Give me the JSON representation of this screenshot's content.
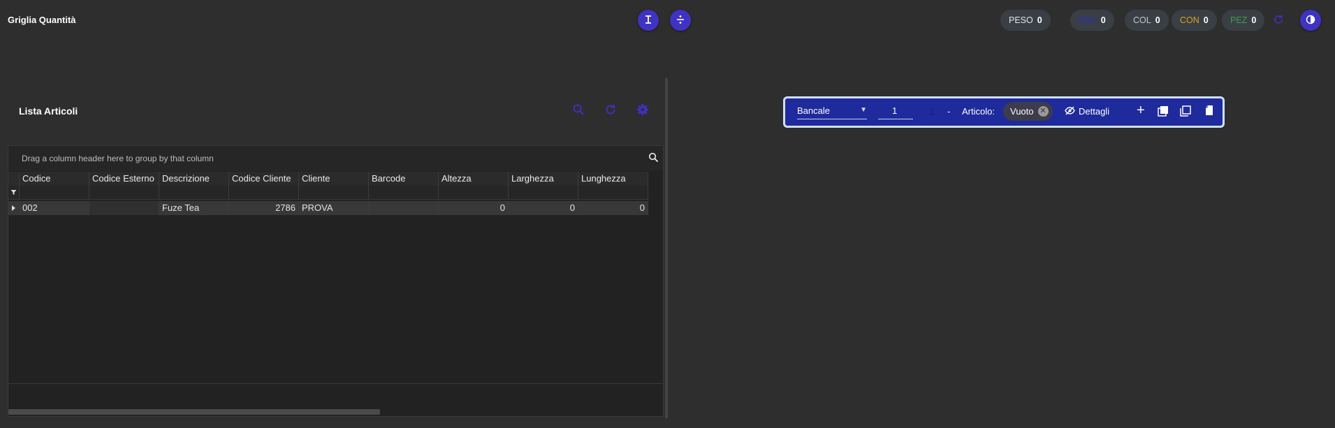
{
  "app": {
    "title": "Griglia Quantità"
  },
  "top_actions": [
    {
      "icon": "text-height-icon",
      "glyph": "Ι"
    },
    {
      "icon": "divide-icon",
      "glyph": "÷"
    }
  ],
  "counters": [
    {
      "label": "PESO",
      "value": "0",
      "color": "#e6e6e6"
    },
    {
      "label": "BAN",
      "value": "0",
      "color": "#2a2fb0"
    },
    {
      "label": "COL",
      "value": "0",
      "color": "#c7c7c7"
    },
    {
      "label": "CON",
      "value": "0",
      "color": "#e0a020"
    },
    {
      "label": "PEZ",
      "value": "0",
      "color": "#3fa04a"
    }
  ],
  "panel": {
    "title": "Lista Articoli",
    "group_hint": "Drag a column header here to group by that column"
  },
  "table": {
    "columns": [
      "Codice",
      "Codice Esterno",
      "Descrizione",
      "Codice Cliente",
      "Cliente",
      "Barcode",
      "Altezza",
      "Larghezza",
      "Lunghezza"
    ],
    "rows": [
      [
        "002",
        "",
        "Fuze Tea",
        "2786",
        "PROVA",
        "",
        "0",
        "0",
        "0"
      ]
    ]
  },
  "toolbar": {
    "type_select": "Bancale",
    "quantity": "1",
    "count": "1",
    "separator": "-",
    "article_label": "Articolo:",
    "article_value": "Vuoto",
    "details_label": "Dettagli"
  },
  "colors": {
    "accent": "#3f33c4",
    "toolbar_bg": "#1f2a9c",
    "background": "#2e2e2e"
  }
}
